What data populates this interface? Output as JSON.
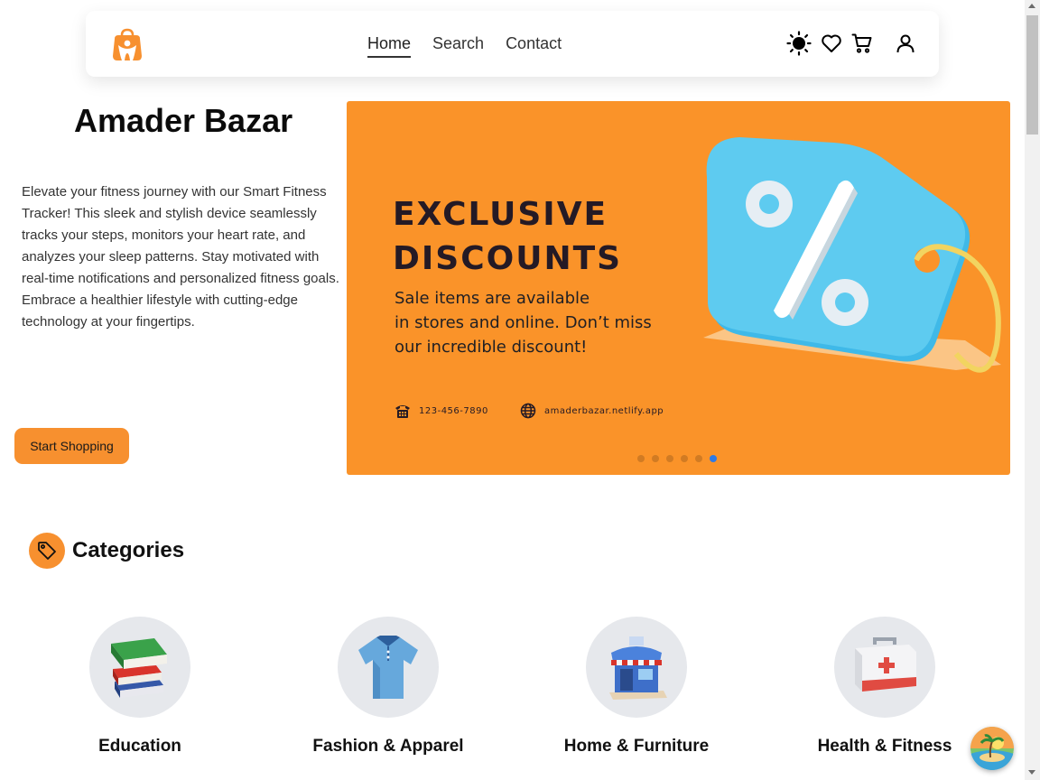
{
  "nav": {
    "links": [
      {
        "label": "Home",
        "active": true
      },
      {
        "label": "Search",
        "active": false
      },
      {
        "label": "Contact",
        "active": false
      }
    ],
    "icons": [
      "sun-icon",
      "heart-icon",
      "cart-icon",
      "user-icon"
    ]
  },
  "hero": {
    "title": "Amader Bazar",
    "text": "Elevate your fitness journey with our Smart Fitness Tracker! This sleek and stylish device seamlessly tracks your steps, monitors your heart rate, and analyzes your sleep patterns. Stay motivated with real-time notifications and personalized fitness goals. Embrace a healthier lifestyle with cutting-edge technology at your fingertips.",
    "cta_label": "Start Shopping"
  },
  "banner": {
    "heading_line1": "EXCLUSIVE",
    "heading_line2": "DISCOUNTS",
    "sub_line1": "Sale items are available",
    "sub_line2": "in stores and online. Don’t miss",
    "sub_line3": "our incredible discount!",
    "phone": "123-456-7890",
    "website": "amaderbazar.netlify.app",
    "slide_count": 6,
    "active_slide": 6
  },
  "categories": {
    "title": "Categories",
    "items": [
      {
        "label": "Education",
        "icon": "books-icon"
      },
      {
        "label": "Fashion & Apparel",
        "icon": "shirt-icon"
      },
      {
        "label": "Home & Furniture",
        "icon": "store-icon"
      },
      {
        "label": "Health & Fitness",
        "icon": "first-aid-icon"
      }
    ]
  },
  "colors": {
    "accent": "#f7902f",
    "banner": "#fa9329",
    "active_dot": "#2f7ae5",
    "tag_blue": "#5ecbf0"
  }
}
